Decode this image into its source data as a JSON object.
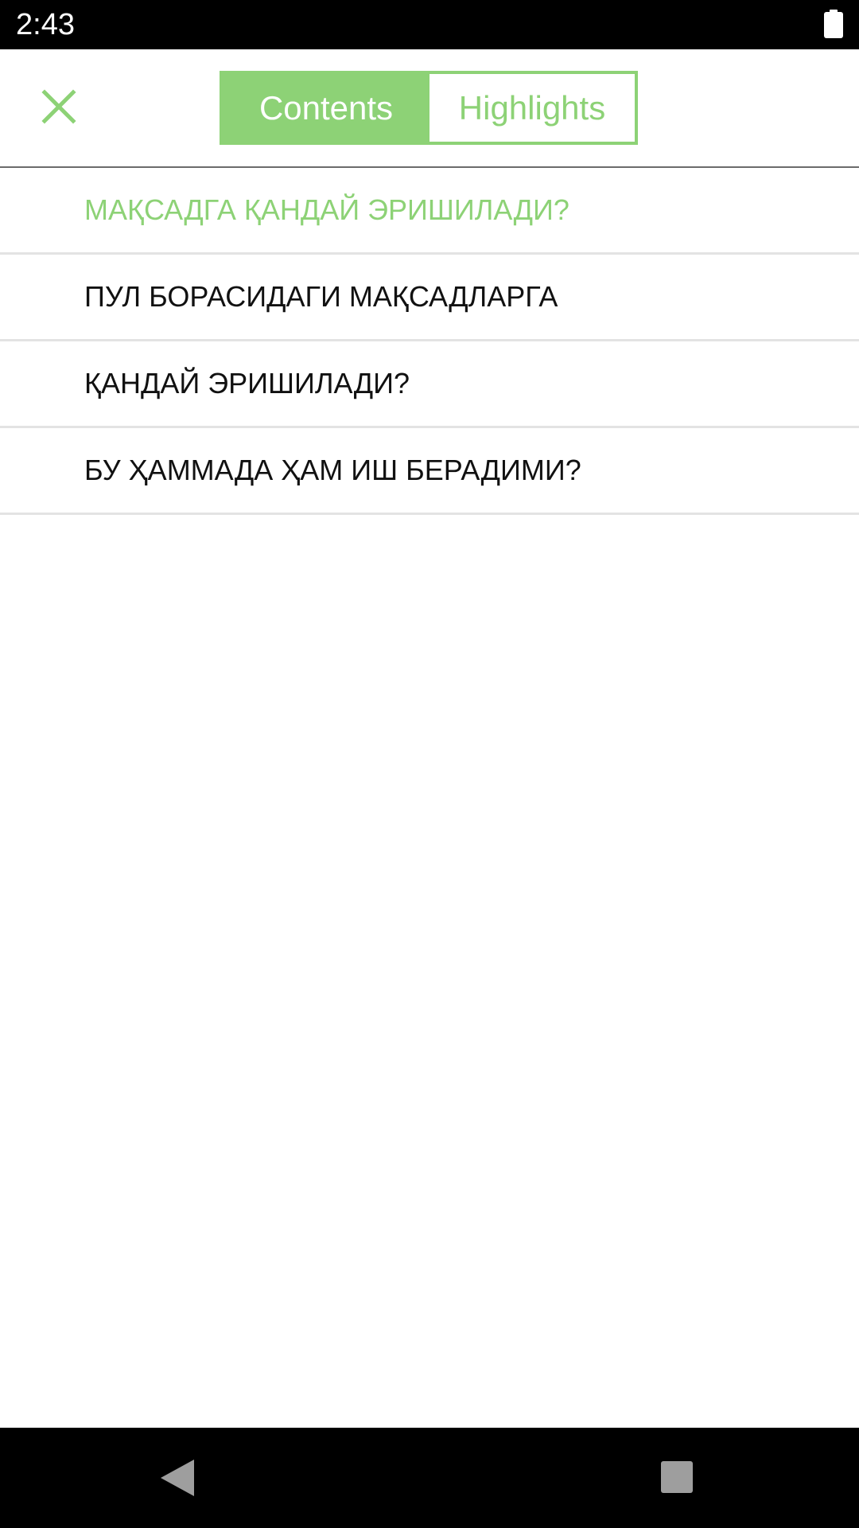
{
  "status_bar": {
    "time": "2:43",
    "battery_icon": "battery-full-icon"
  },
  "toolbar": {
    "close_icon": "close-icon",
    "tabs": [
      {
        "label": "Contents",
        "active": true
      },
      {
        "label": "Highlights",
        "active": false
      }
    ]
  },
  "toc": {
    "items": [
      {
        "label": "МАҚСАДГА ҚАНДАЙ ЭРИШИЛАДИ?",
        "current": true
      },
      {
        "label": "ПУЛ БОРАСИДАГИ МАҚСАДЛАРГА",
        "current": false
      },
      {
        "label": "ҚАНДАЙ ЭРИШИЛАДИ?",
        "current": false
      },
      {
        "label": "БУ ҲАММАДА ҲАМ ИШ БЕРАДИМИ?",
        "current": false
      }
    ]
  },
  "nav_bar": {
    "back_icon": "back-triangle-icon",
    "recents_icon": "recents-square-icon"
  },
  "colors": {
    "accent": "#8dd276",
    "text": "#111111",
    "divider": "#e3e3e3",
    "system_bar": "#000000"
  }
}
